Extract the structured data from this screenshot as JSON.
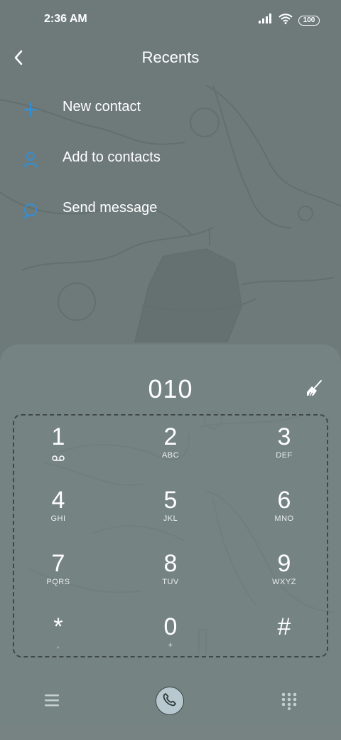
{
  "status_bar": {
    "time": "2:36 AM",
    "battery": "100",
    "icons": [
      "signal-icon",
      "wifi-icon",
      "battery-icon"
    ]
  },
  "header": {
    "title": "Recents",
    "back_icon": "back-arrow-icon"
  },
  "actions": [
    {
      "label": "New contact",
      "icon": "plus-icon"
    },
    {
      "label": "Add to contacts",
      "icon": "person-icon"
    },
    {
      "label": "Send message",
      "icon": "message-bubble-icon"
    }
  ],
  "dialer": {
    "number": "010",
    "clear_icon": "broom-icon",
    "keys": [
      {
        "digit": "1",
        "letters": "",
        "icon": "voicemail-icon"
      },
      {
        "digit": "2",
        "letters": "ABC"
      },
      {
        "digit": "3",
        "letters": "DEF"
      },
      {
        "digit": "4",
        "letters": "GHI"
      },
      {
        "digit": "5",
        "letters": "JKL"
      },
      {
        "digit": "6",
        "letters": "MNO"
      },
      {
        "digit": "7",
        "letters": "PQRS"
      },
      {
        "digit": "8",
        "letters": "TUV"
      },
      {
        "digit": "9",
        "letters": "WXYZ"
      },
      {
        "digit": "*",
        "letters": ","
      },
      {
        "digit": "0",
        "letters": "+"
      },
      {
        "digit": "#",
        "letters": ""
      }
    ]
  },
  "bottom_bar": {
    "icons": [
      "menu-icon",
      "phone-icon",
      "dialpad-icon"
    ]
  },
  "colors": {
    "background": "#6e7a7a",
    "accent": "#2f8fd8",
    "text": "#ffffff",
    "call_button": "#b7c8cf"
  }
}
